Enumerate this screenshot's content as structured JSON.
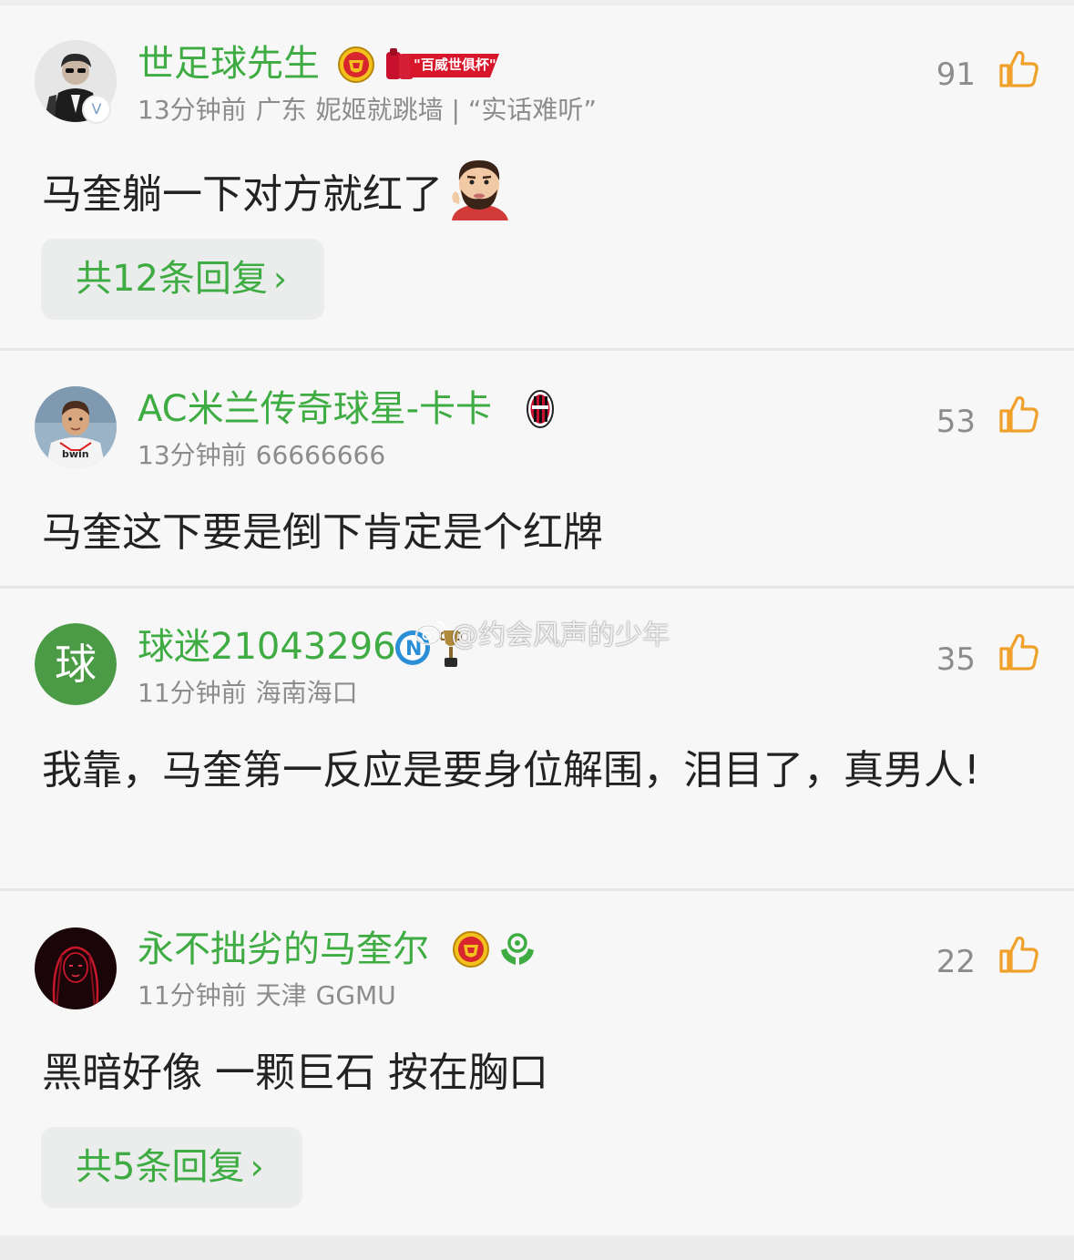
{
  "colors": {
    "username": "#3eac42",
    "meta": "#8c8c8c",
    "like_icon": "#f0a12b",
    "content": "#222222",
    "reply_bg": "#ebecec"
  },
  "watermark": {
    "text": "@约会风声的少年",
    "icon": "weibo-logo-icon"
  },
  "comments": [
    {
      "username": "世足球先生",
      "badges": [
        "man-united-crest-icon",
        "budweiser-world-cup-badge"
      ],
      "badge_text": "\"百威世俱杯\"",
      "time": "13分钟前",
      "location": "广东",
      "extra": "妮姬就跳墙 | “实话难听”",
      "likes": "91",
      "content": "马奎躺一下对方就红了",
      "sticker": "bearded-man-sticker",
      "reply": "共12条回复"
    },
    {
      "username": "AC米兰传奇球星-卡卡",
      "badges": [
        "ac-milan-crest-icon"
      ],
      "time": "13分钟前",
      "extra": "66666666",
      "likes": "53",
      "content": "马奎这下要是倒下肯定是个红牌"
    },
    {
      "username": "球迷21043296",
      "avatar_letter": "球",
      "badges": [
        "napoli-crest-icon",
        "trophy-icon"
      ],
      "time": "11分钟前",
      "location": "海南海口",
      "likes": "35",
      "content": "我靠，马奎第一反应是要身位解围，泪目了，真男人!"
    },
    {
      "username": "永不拙劣的马奎尔",
      "badges": [
        "man-united-crest-icon",
        "green-charity-icon"
      ],
      "time": "11分钟前",
      "location": "天津",
      "extra": "GGMU",
      "likes": "22",
      "content": "黑暗好像 一颗巨石 按在胸口",
      "reply": "共5条回复"
    }
  ]
}
